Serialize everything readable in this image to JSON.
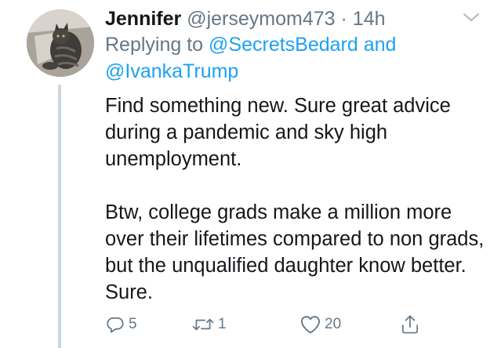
{
  "tweet": {
    "author_name": "Jennifer",
    "handle": "@jerseymom473",
    "separator": "·",
    "time": "14h",
    "reply_prefix": "Replying to",
    "reply_mention_1": "@SecretsBedard",
    "reply_and": "and",
    "reply_mention_2": "@IvankaTrump",
    "paragraphs": [
      "Find something new. Sure great advice during a pandemic and sky high unemployment.",
      "Btw, college grads make a million more over their lifetimes compared to non grads, but the unqualified daughter know better. Sure."
    ],
    "counts": {
      "replies": "5",
      "retweets": "1",
      "likes": "20"
    }
  },
  "icons": {
    "avatar": "cat-photo-avatar",
    "menu": "chevron-down-icon",
    "reply": "reply-icon",
    "retweet": "retweet-icon",
    "like": "heart-icon",
    "share": "share-icon"
  },
  "colors": {
    "text": "#14171a",
    "secondary": "#657786",
    "link": "#1da1f2",
    "thread_line": "#cdd6dd"
  }
}
